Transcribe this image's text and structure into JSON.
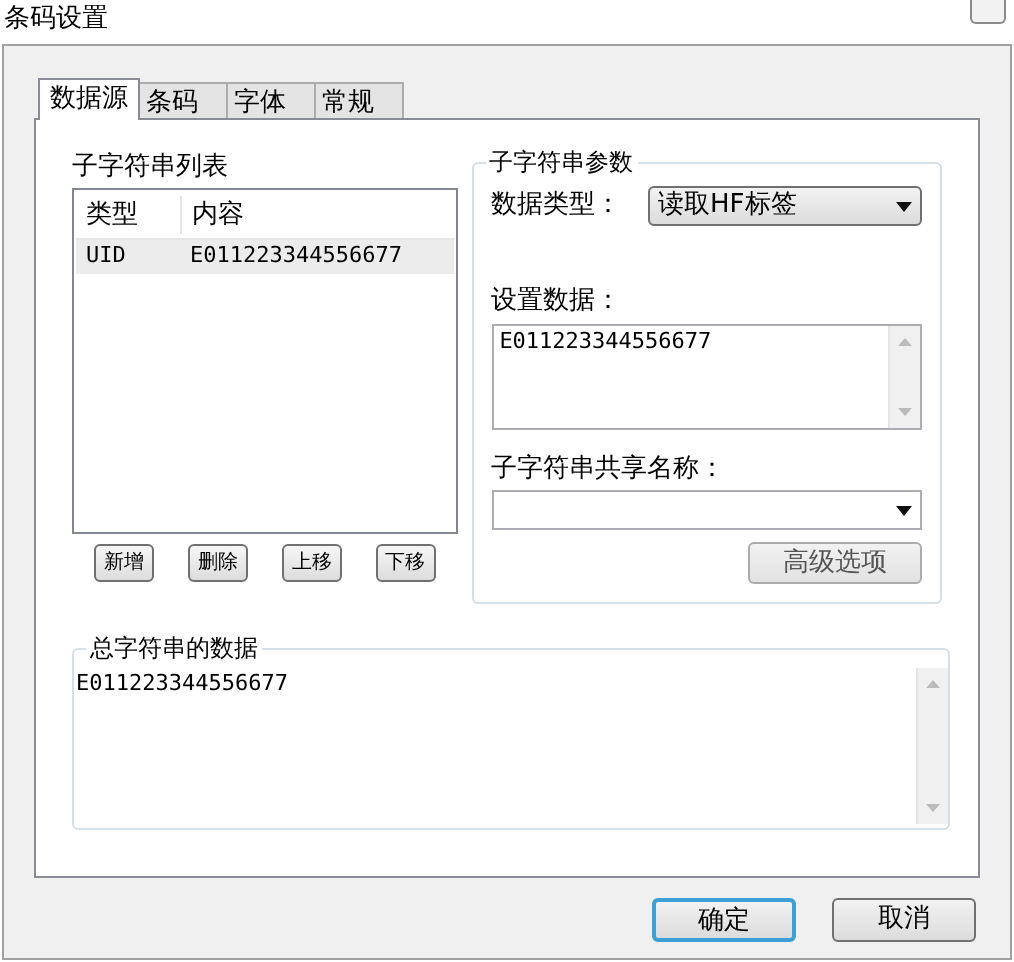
{
  "window": {
    "title": "条码设置"
  },
  "tabs": [
    {
      "label": "数据源",
      "selected": true
    },
    {
      "label": "条码",
      "selected": false
    },
    {
      "label": "字体",
      "selected": false
    },
    {
      "label": "常规",
      "selected": false
    }
  ],
  "substring_list": {
    "title": "子字符串列表",
    "columns": [
      "类型",
      "内容"
    ],
    "rows": [
      {
        "cells": [
          "UID",
          "E011223344556677"
        ],
        "selected": true
      }
    ]
  },
  "list_buttons": [
    "新增",
    "删除",
    "上移",
    "下移"
  ],
  "substring_params": {
    "title": "子字符串参数",
    "data_type_label": "数据类型：",
    "data_type_value": "读取HF标签",
    "set_data_label": "设置数据：",
    "set_data_value": "E011223344556677",
    "share_name_label": "子字符串共享名称：",
    "advanced_button": "高级选项"
  },
  "total_data": {
    "title": "总字符串的数据",
    "value": "E011223344556677"
  },
  "buttons": [
    {
      "label": "确定",
      "default": true
    },
    {
      "label": "取消",
      "default": false
    }
  ]
}
